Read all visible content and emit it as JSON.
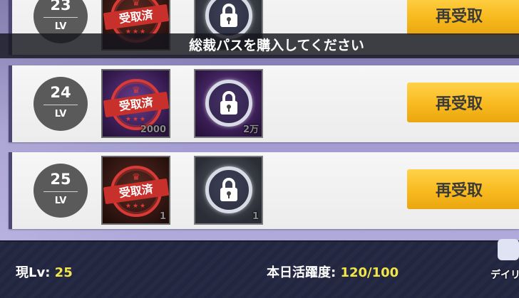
{
  "rows": [
    {
      "level": "23",
      "lv_label": "LV",
      "free_reward": {
        "stamp": "受取済",
        "qty": ""
      },
      "pass_reward": {
        "qty": ""
      },
      "button": "再受取"
    },
    {
      "level": "24",
      "lv_label": "LV",
      "free_reward": {
        "stamp": "受取済",
        "qty": "2000"
      },
      "pass_reward": {
        "qty": "2万"
      },
      "button": "再受取"
    },
    {
      "level": "25",
      "lv_label": "LV",
      "free_reward": {
        "stamp": "受取済",
        "qty": "1"
      },
      "pass_reward": {
        "qty": "1"
      },
      "button": "再受取"
    }
  ],
  "banner": "総裁パスを購入してください",
  "footer": {
    "current_lv_label": "現Lv: ",
    "current_lv_value": "25",
    "activity_label": "本日活躍度: ",
    "activity_value": "120/100",
    "daily_button": "デイリ"
  },
  "icons": {
    "stamp": "claimed-stamp-icon",
    "lock": "lock-icon",
    "daily": "gift-icon"
  },
  "colors": {
    "button": "#f7b81c",
    "stamp": "#d93a36",
    "highlight": "#f2e64b",
    "footer": "#262a43"
  }
}
